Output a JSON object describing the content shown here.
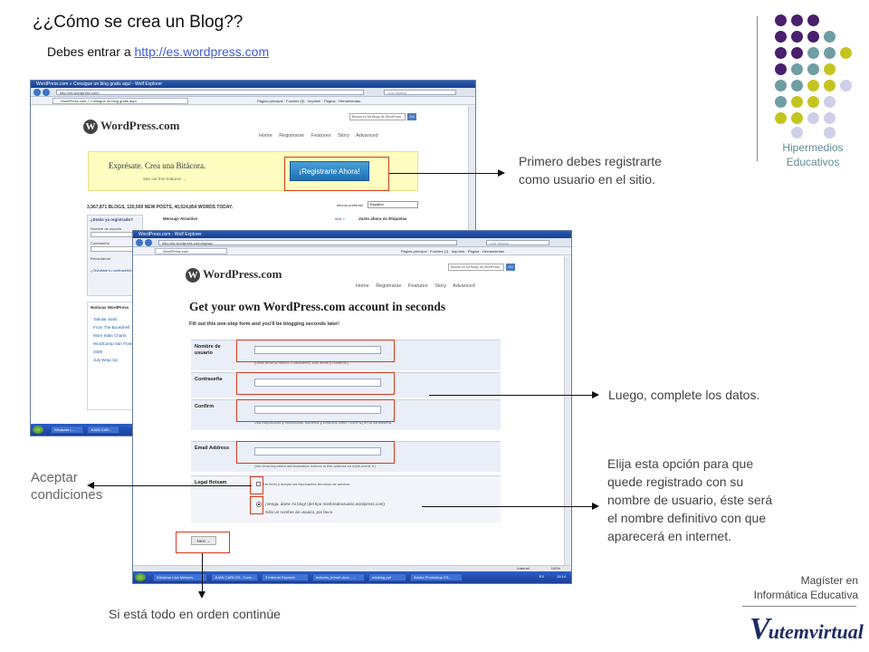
{
  "slide": {
    "title": "¿¿Cómo se crea un Blog??",
    "subtitle_prefix": "Debes entrar a ",
    "subtitle_link": "http://es.wordpress.com",
    "brand_line1": "Hipermedios",
    "brand_line2": "Educativos",
    "footer_line1": "Magíster en",
    "footer_line2": "Informática Educativa",
    "logo_text": "utemvirtual",
    "logo_initial": "V"
  },
  "notes": {
    "register": "Primero debes registrarte como usuario en el sitio.",
    "complete": "Luego, complete los datos.",
    "option": "Elija esta opción para que quede registrado con su nombre de usuario, éste será el nombre definitivo con que aparecerá en internet.",
    "accept": "Aceptar condiciones",
    "continue": "Si está todo en orden continúe"
  },
  "dot_colors": {
    "purple": "#4a1f6b",
    "teal": "#6e9ea3",
    "olive": "#c4c420",
    "lavender": "#cfcfea"
  },
  "browser_back": {
    "title": "WordPress.com » Consigue un blog gratis aquí - Wolf Explorer",
    "address": "http://es.wordpress.com/",
    "search": "Live Search",
    "tab": "WordPress.com » Consigue un blog gratis aquí",
    "tools": [
      "Página principal",
      "Fuentes (3)",
      "Imprimir",
      "Página",
      "Herramientas"
    ],
    "wp_logo": "WordPress.com",
    "search_box": "Buscar en los Blogs de WordPress",
    "search_go": "Go",
    "nav": [
      "Home",
      "Registrarse",
      "Features",
      "Story",
      "Advanced"
    ],
    "banner_text": "Exprésate. Crea una Bitácora.",
    "banner_link": "See our free features →",
    "register_button": "¡Registrarte Ahora!",
    "stats": "3,967,871 BLOGS, 120,569 NEW POSTS, 40,024,854 WORDS TODAY.",
    "idioma_label": "Idioma preferido",
    "idioma_value": "Español",
    "login_title": "¿Estás ya registrado?",
    "login_user": "Nombre de usuario",
    "login_pass": "Contraseña",
    "remember": "Recordarme",
    "forgot": "¿Olvidaste tu contraseña?",
    "news_title": "Noticias WordPress",
    "news_items": [
      "Tabular Stats",
      "From The Bookshelf",
      "More Stats Charts",
      "WordCamp San Francisco 2008",
      "July Wrap Up"
    ],
    "attractive": "Mensaje Atractivo",
    "mas": "Más »",
    "hot": "Justo ahora en Etiquetas",
    "taskbar": [
      "Windows L...",
      "JUAN CAR..."
    ]
  },
  "browser_front": {
    "title": "WordPress.com - Wolf Explorer",
    "address": "http://es.wordpress.com/signup/",
    "search": "Live Search",
    "tab": "WordPress.com",
    "tools": [
      "Página principal",
      "Fuentes (J)",
      "Imprimir",
      "Página",
      "Herramientas"
    ],
    "wp_logo": "WordPress.com",
    "search_box": "Buscar en los Blogs de WordPress",
    "search_go": "Go",
    "nav": [
      "Home",
      "Registrarse",
      "Features",
      "Story",
      "Advanced"
    ],
    "heading": "Get your own WordPress.com account in seconds",
    "subheading": "Fill out this one-step form and you'll be blogging seconds later!",
    "fields": [
      {
        "label": "Nombre de usuario",
        "help": "(Debe tener al menos 4 caracteres, sólo letras y números.)"
      },
      {
        "label": "Contraseña",
        "help": ""
      },
      {
        "label": "Confirm",
        "help": "Usa mayúsculas y minúsculas, números y símbolos como !\"£$%^&( en tu contraseña."
      },
      {
        "label": "Email Address",
        "help": "(We send important administration notices to this address so triple-check it.)"
      }
    ],
    "legal_label": "Legal flotsam",
    "legal_text": "He leído y acepto los fascinantes términos de servicio.",
    "option1": "¡Venga, dame mi blog! (del tipo nombredeusuario.wordpress.com)",
    "option2": "Sólo un nombre de usuario, por favor.",
    "next_button": "Next →",
    "status": "Internet",
    "zoom": "100%",
    "taskbar": [
      "Windows Live Messen...",
      "JUAN CARLOS - Conv...",
      "3 Internet Explorer",
      "lectures_tema2.docx - ...",
      "edublog.ppt",
      "Adobe Photoshop CS...",
      "ES",
      "15:14"
    ]
  }
}
